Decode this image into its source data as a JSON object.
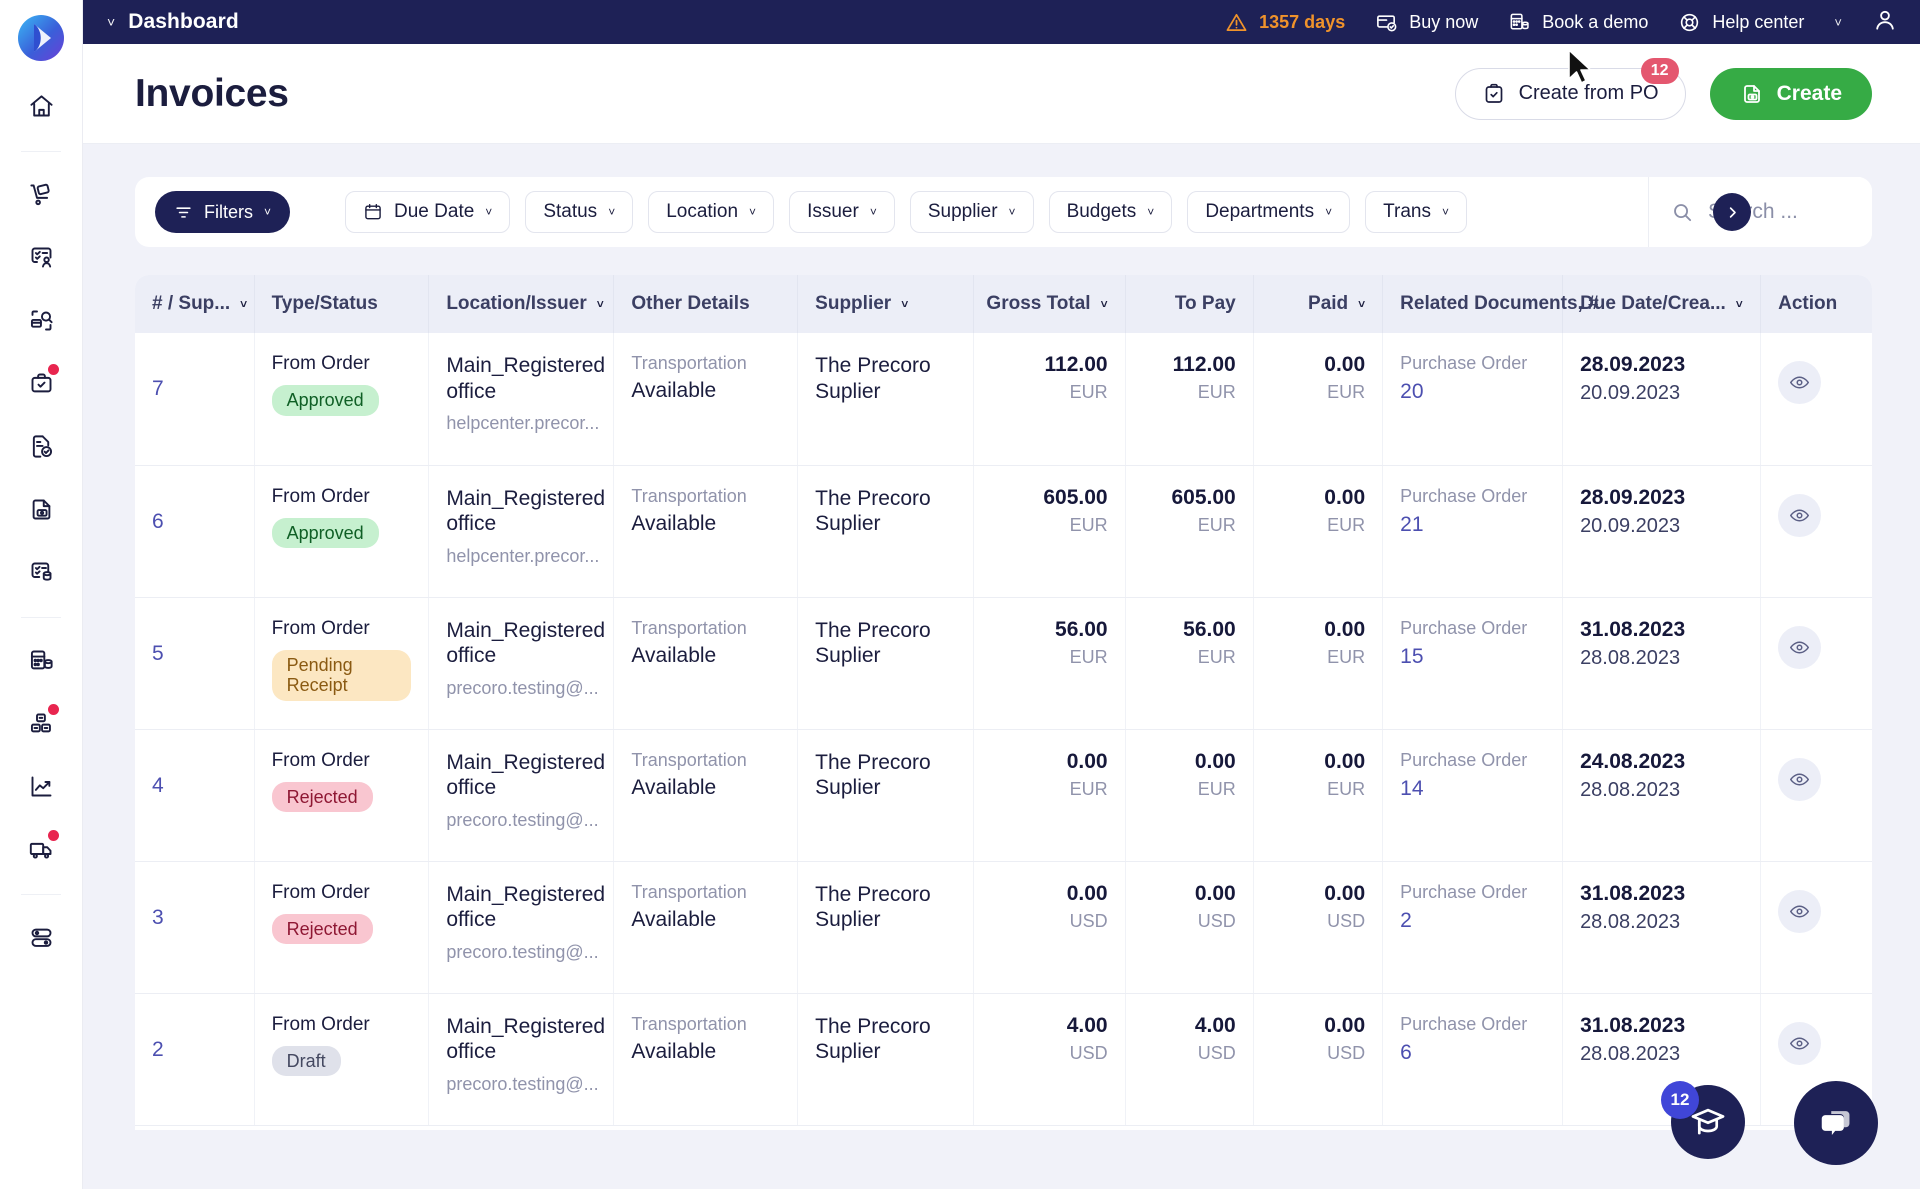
{
  "colors": {
    "navy": "#1e2156",
    "green": "#36ab45",
    "accent_blue": "#4c4fb0",
    "warning_orange": "#f0932b",
    "badge_red": "#e4576f"
  },
  "topbar": {
    "title": "Dashboard",
    "trial_days": "1357 days",
    "buy_now": "Buy now",
    "book_demo": "Book a demo",
    "help_center": "Help center"
  },
  "header": {
    "title": "Invoices",
    "create_from_po": "Create from PO",
    "create_from_po_badge": "12",
    "create": "Create"
  },
  "filters": {
    "filters_label": "Filters",
    "chips": [
      {
        "label": "Due Date",
        "icon": "calendar-icon"
      },
      {
        "label": "Status",
        "icon": null
      },
      {
        "label": "Location",
        "icon": null
      },
      {
        "label": "Issuer",
        "icon": null
      },
      {
        "label": "Supplier",
        "icon": null
      },
      {
        "label": "Budgets",
        "icon": null
      },
      {
        "label": "Departments",
        "icon": null
      },
      {
        "label": "Trans",
        "icon": null
      }
    ],
    "search_placeholder": "Search ..."
  },
  "table": {
    "columns": [
      {
        "label": "# / Sup...",
        "sortable": true,
        "align": "left"
      },
      {
        "label": "Type/Status",
        "sortable": false,
        "align": "left"
      },
      {
        "label": "Location/Issuer",
        "sortable": true,
        "align": "left"
      },
      {
        "label": "Other Details",
        "sortable": false,
        "align": "left"
      },
      {
        "label": "Supplier",
        "sortable": true,
        "align": "left"
      },
      {
        "label": "Gross Total",
        "sortable": true,
        "align": "right"
      },
      {
        "label": "To Pay",
        "sortable": false,
        "align": "right"
      },
      {
        "label": "Paid",
        "sortable": true,
        "align": "right"
      },
      {
        "label": "Related Documents, #",
        "sortable": false,
        "align": "left"
      },
      {
        "label": "Due Date/Crea...",
        "sortable": true,
        "align": "left"
      },
      {
        "label": "Action",
        "sortable": false,
        "align": "left"
      }
    ],
    "rows": [
      {
        "id": "7",
        "type": "From Order",
        "status": "Approved",
        "status_kind": "approved",
        "location": "Main_Registered office",
        "issuer": "helpcenter.precor...",
        "other_label": "Transportation",
        "other_value": "Available",
        "supplier": "The Precoro Suplier",
        "gross_total": "112.00",
        "gross_currency": "EUR",
        "to_pay": "112.00",
        "to_pay_currency": "EUR",
        "paid": "0.00",
        "paid_currency": "EUR",
        "related_label": "Purchase Order",
        "related_number": "20",
        "due_date": "28.09.2023",
        "created_date": "20.09.2023"
      },
      {
        "id": "6",
        "type": "From Order",
        "status": "Approved",
        "status_kind": "approved",
        "location": "Main_Registered office",
        "issuer": "helpcenter.precor...",
        "other_label": "Transportation",
        "other_value": "Available",
        "supplier": "The Precoro Suplier",
        "gross_total": "605.00",
        "gross_currency": "EUR",
        "to_pay": "605.00",
        "to_pay_currency": "EUR",
        "paid": "0.00",
        "paid_currency": "EUR",
        "related_label": "Purchase Order",
        "related_number": "21",
        "due_date": "28.09.2023",
        "created_date": "20.09.2023"
      },
      {
        "id": "5",
        "type": "From Order",
        "status": "Pending Receipt",
        "status_kind": "pending",
        "location": "Main_Registered office",
        "issuer": "precoro.testing@...",
        "other_label": "Transportation",
        "other_value": "Available",
        "supplier": "The Precoro Suplier",
        "gross_total": "56.00",
        "gross_currency": "EUR",
        "to_pay": "56.00",
        "to_pay_currency": "EUR",
        "paid": "0.00",
        "paid_currency": "EUR",
        "related_label": "Purchase Order",
        "related_number": "15",
        "due_date": "31.08.2023",
        "created_date": "28.08.2023"
      },
      {
        "id": "4",
        "type": "From Order",
        "status": "Rejected",
        "status_kind": "rejected",
        "location": "Main_Registered office",
        "issuer": "precoro.testing@...",
        "other_label": "Transportation",
        "other_value": "Available",
        "supplier": "The Precoro Suplier",
        "gross_total": "0.00",
        "gross_currency": "EUR",
        "to_pay": "0.00",
        "to_pay_currency": "EUR",
        "paid": "0.00",
        "paid_currency": "EUR",
        "related_label": "Purchase Order",
        "related_number": "14",
        "due_date": "24.08.2023",
        "created_date": "28.08.2023"
      },
      {
        "id": "3",
        "type": "From Order",
        "status": "Rejected",
        "status_kind": "rejected",
        "location": "Main_Registered office",
        "issuer": "precoro.testing@...",
        "other_label": "Transportation",
        "other_value": "Available",
        "supplier": "The Precoro Suplier",
        "gross_total": "0.00",
        "gross_currency": "USD",
        "to_pay": "0.00",
        "to_pay_currency": "USD",
        "paid": "0.00",
        "paid_currency": "USD",
        "related_label": "Purchase Order",
        "related_number": "2",
        "due_date": "31.08.2023",
        "created_date": "28.08.2023"
      },
      {
        "id": "2",
        "type": "From Order",
        "status": "Draft",
        "status_kind": "draft",
        "location": "Main_Registered office",
        "issuer": "precoro.testing@...",
        "other_label": "Transportation",
        "other_value": "Available",
        "supplier": "The Precoro Suplier",
        "gross_total": "4.00",
        "gross_currency": "USD",
        "to_pay": "4.00",
        "to_pay_currency": "USD",
        "paid": "0.00",
        "paid_currency": "USD",
        "related_label": "Purchase Order",
        "related_number": "6",
        "due_date": "31.08.2023",
        "created_date": "28.08.2023"
      }
    ]
  },
  "sidebar": {
    "items": [
      {
        "icon": "home-icon",
        "badge": false
      },
      {
        "icon": "hand-truck-icon",
        "badge": false
      },
      {
        "icon": "request-user-icon",
        "badge": false
      },
      {
        "icon": "order-search-icon",
        "badge": false
      },
      {
        "icon": "receipt-check-icon",
        "badge": true
      },
      {
        "icon": "document-check-icon",
        "badge": false
      },
      {
        "icon": "invoice-icon",
        "badge": false
      },
      {
        "icon": "expense-list-icon",
        "badge": false
      },
      {
        "icon": "calculator-coins-icon",
        "badge": false
      },
      {
        "icon": "inventory-boxes-icon",
        "badge": true
      },
      {
        "icon": "analytics-chart-icon",
        "badge": false
      },
      {
        "icon": "delivery-truck-icon",
        "badge": true
      },
      {
        "icon": "toggles-icon",
        "badge": false
      }
    ]
  },
  "floating": {
    "learn_badge": "12",
    "learn_icon": "graduation-cap-icon",
    "chat_icon": "chat-bubble-icon"
  }
}
